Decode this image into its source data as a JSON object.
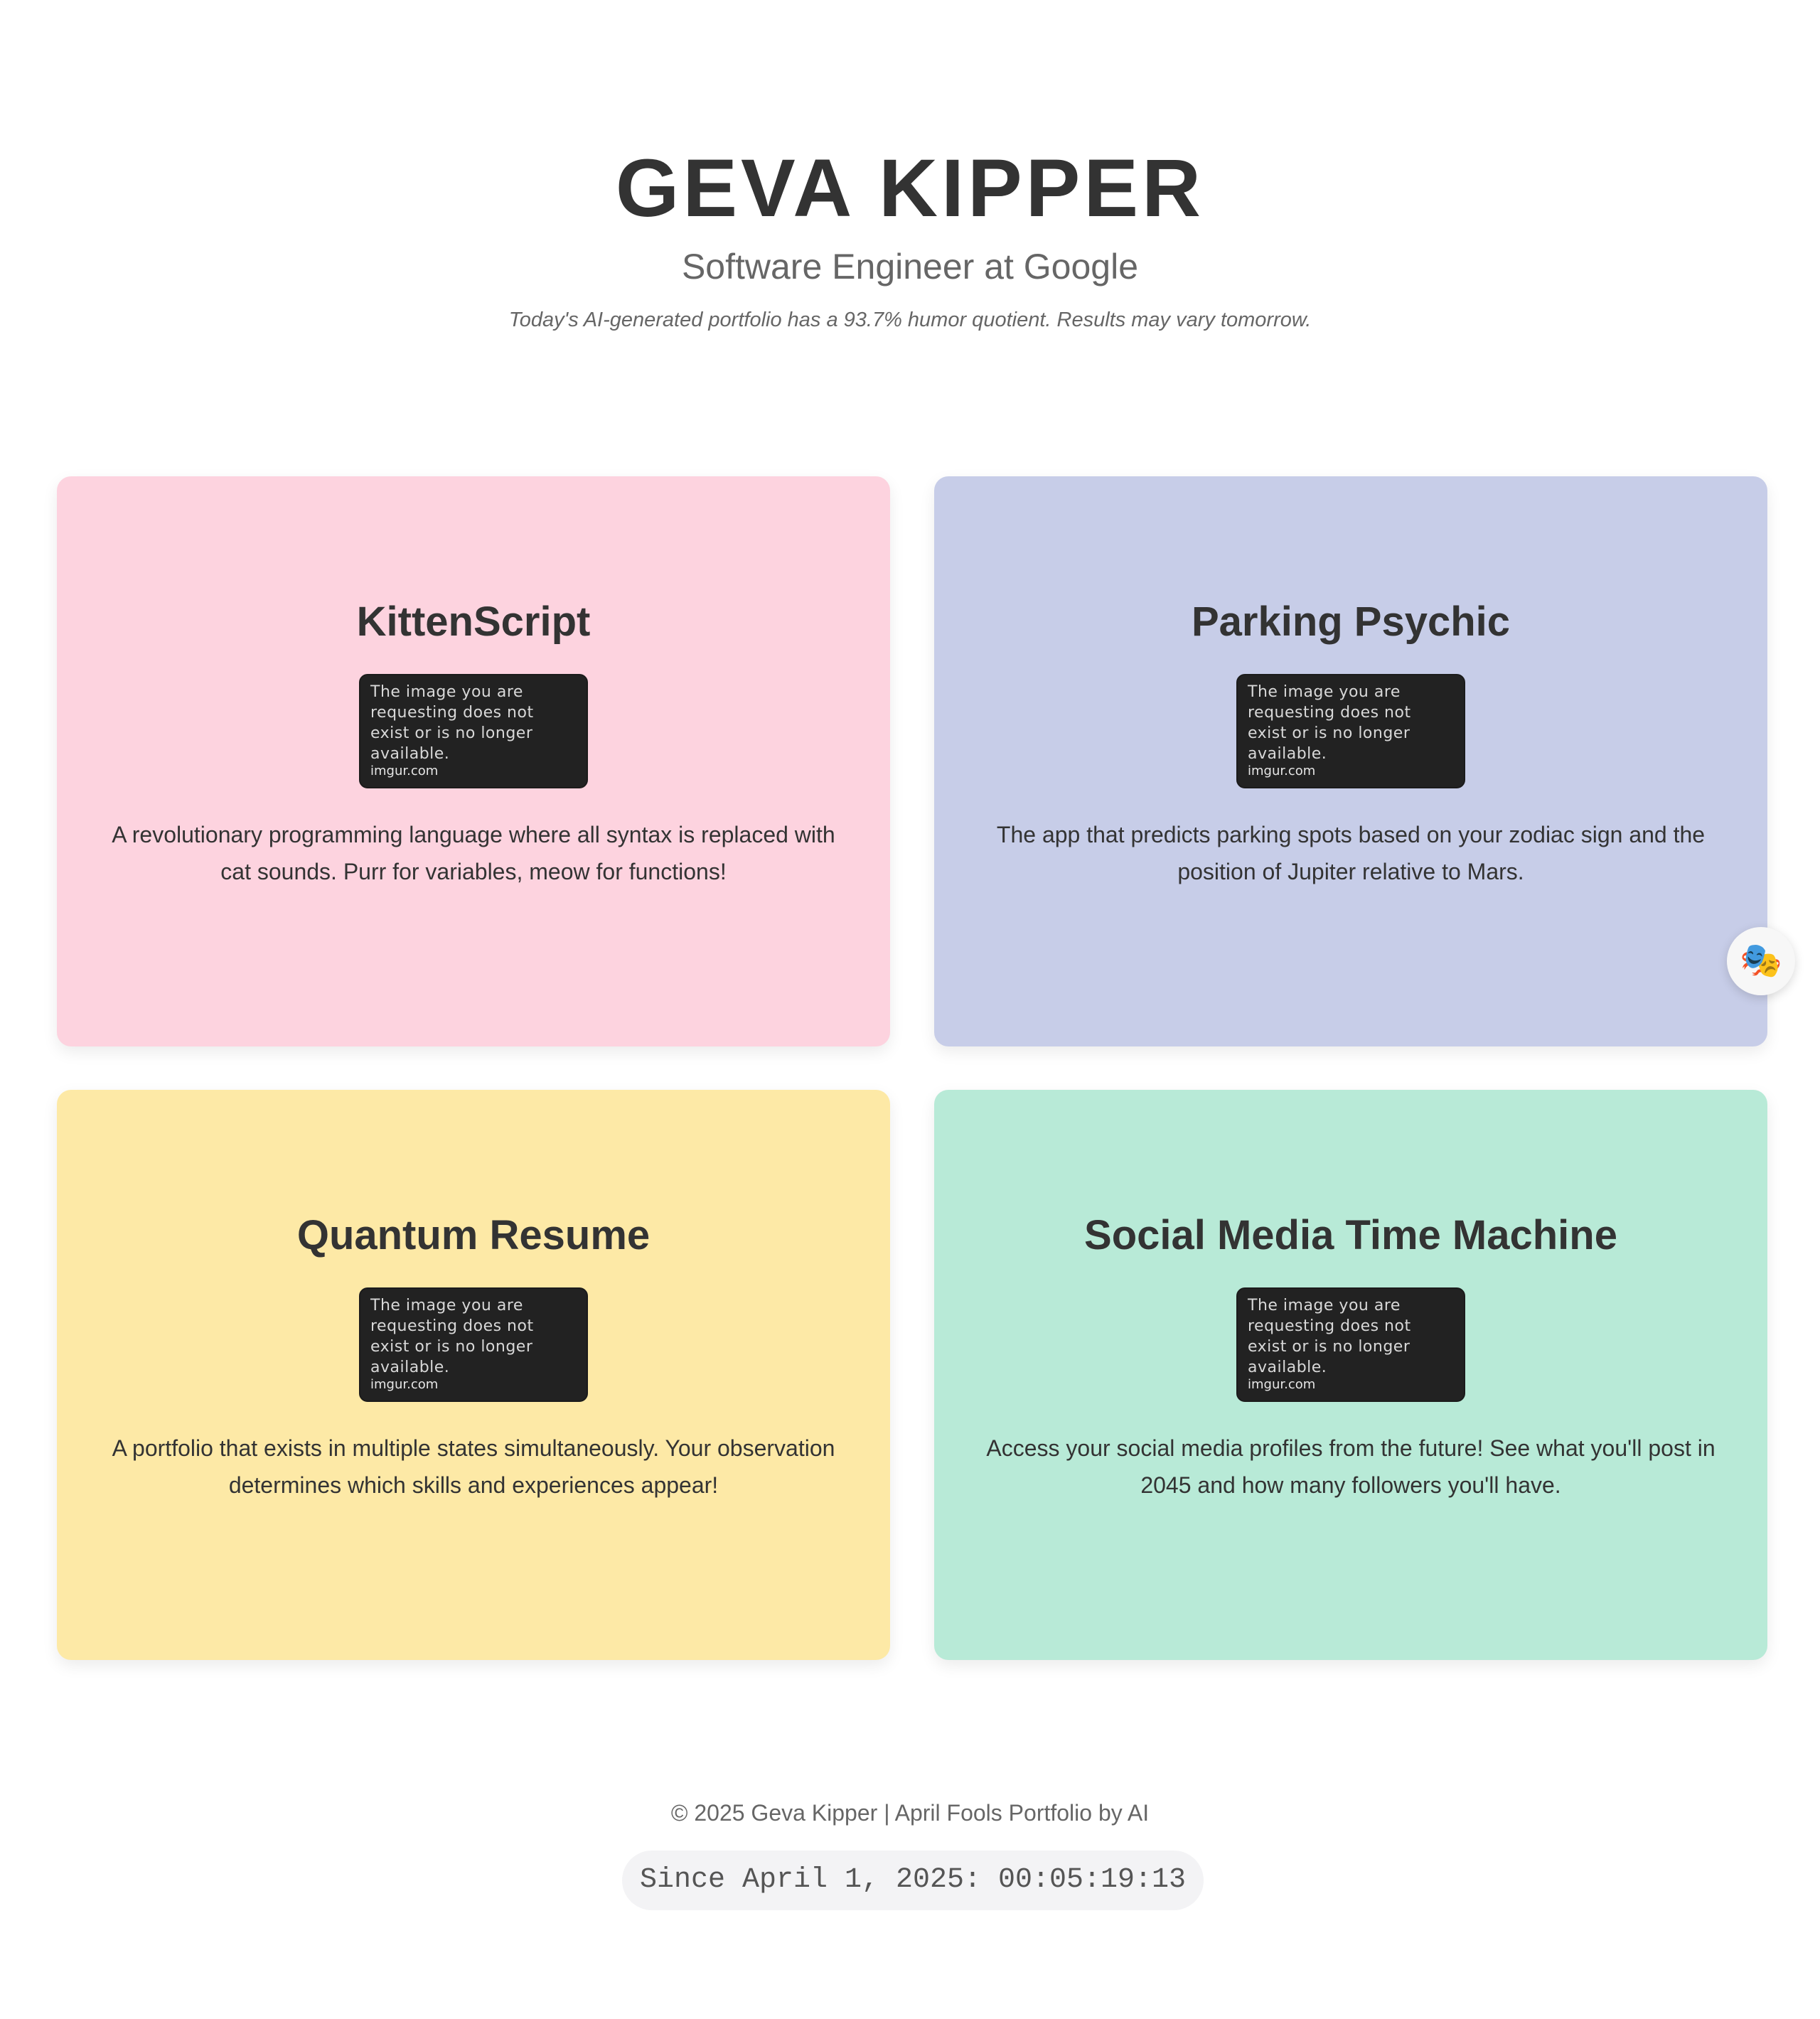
{
  "header": {
    "name": "GEVA KIPPER",
    "subtitle": "Software Engineer at Google",
    "tagline": "Today's AI-generated portfolio has a 93.7% humor quotient. Results may vary tomorrow."
  },
  "projects": [
    {
      "title": "KittenScript",
      "image_message": "The image you are requesting does not exist or is no longer available.",
      "image_source": "imgur.com",
      "description": "A revolutionary programming language where all syntax is replaced with cat sounds. Purr for variables, meow for functions!",
      "color": "#fdd3df"
    },
    {
      "title": "Parking Psychic",
      "image_message": "The image you are requesting does not exist or is no longer available.",
      "image_source": "imgur.com",
      "description": "The app that predicts parking spots based on your zodiac sign and the position of Jupiter relative to Mars.",
      "color": "#c7cde8"
    },
    {
      "title": "Quantum Resume",
      "image_message": "The image you are requesting does not exist or is no longer available.",
      "image_source": "imgur.com",
      "description": "A portfolio that exists in multiple states simultaneously. Your observation determines which skills and experiences appear!",
      "color": "#fde9a6"
    },
    {
      "title": "Social Media Time Machine",
      "image_message": "The image you are requesting does not exist or is no longer available.",
      "image_source": "imgur.com",
      "description": "Access your social media profiles from the future! See what you'll post in 2045 and how many followers you'll have.",
      "color": "#b8ead7"
    }
  ],
  "fab": {
    "icon": "theater-masks-icon",
    "glyph": "🎭"
  },
  "footer": {
    "text": "© 2025 Geva Kipper | April Fools Portfolio by AI",
    "counter": "Since April 1, 2025: 00:05:19:13"
  }
}
